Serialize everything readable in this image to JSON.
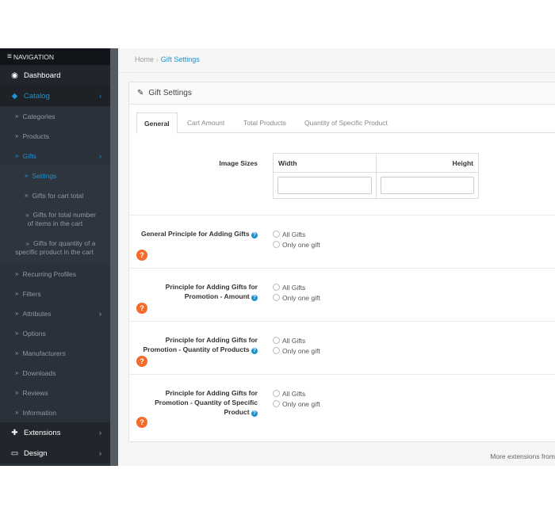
{
  "nav": {
    "header": "NAVIGATION",
    "dashboard": "Dashboard",
    "catalog": "Catalog",
    "categories": "Categories",
    "products": "Products",
    "gifts": "Gifts",
    "settings": "Settings",
    "gifts_cart_total": "Gifts for cart total",
    "gifts_total_number_1": "Gifts for total number",
    "gifts_total_number_2": "of items in the cart",
    "gifts_quantity_1": "Gifts for quantity of a",
    "gifts_quantity_2": "specific product in the cart",
    "recurring": "Recurring Profiles",
    "filters": "Filters",
    "attributes": "Attributes",
    "options": "Options",
    "manufacturers": "Manufacturers",
    "downloads": "Downloads",
    "reviews": "Reviews",
    "information": "Information",
    "extensions": "Extensions",
    "design": "Design"
  },
  "breadcrumb": {
    "home": "Home",
    "current": "Gift Settings"
  },
  "panel": {
    "title": "Gift Settings"
  },
  "tabs": [
    "General",
    "Cart Amount",
    "Total Products",
    "Quantity of Specific Product"
  ],
  "image_sizes": {
    "label": "Image Sizes",
    "width_header": "Width",
    "height_header": "Height",
    "width_value": "",
    "height_value": ""
  },
  "fields": [
    {
      "label_1": "General Principle for Adding Gifts",
      "label_2": "",
      "label_3": ""
    },
    {
      "label_1": "Principle for Adding Gifts for",
      "label_2": "Promotion - Amount",
      "label_3": ""
    },
    {
      "label_1": "Principle for Adding Gifts for",
      "label_2": "Promotion - Quantity of Products",
      "label_3": ""
    },
    {
      "label_1": "Principle for Adding Gifts for",
      "label_2": "Promotion - Quantity of Specific",
      "label_3": "Product"
    }
  ],
  "radio_options": {
    "all": "All Gifts",
    "one": "Only one gift"
  },
  "help_glyph": "?",
  "footer": "More extensions from"
}
